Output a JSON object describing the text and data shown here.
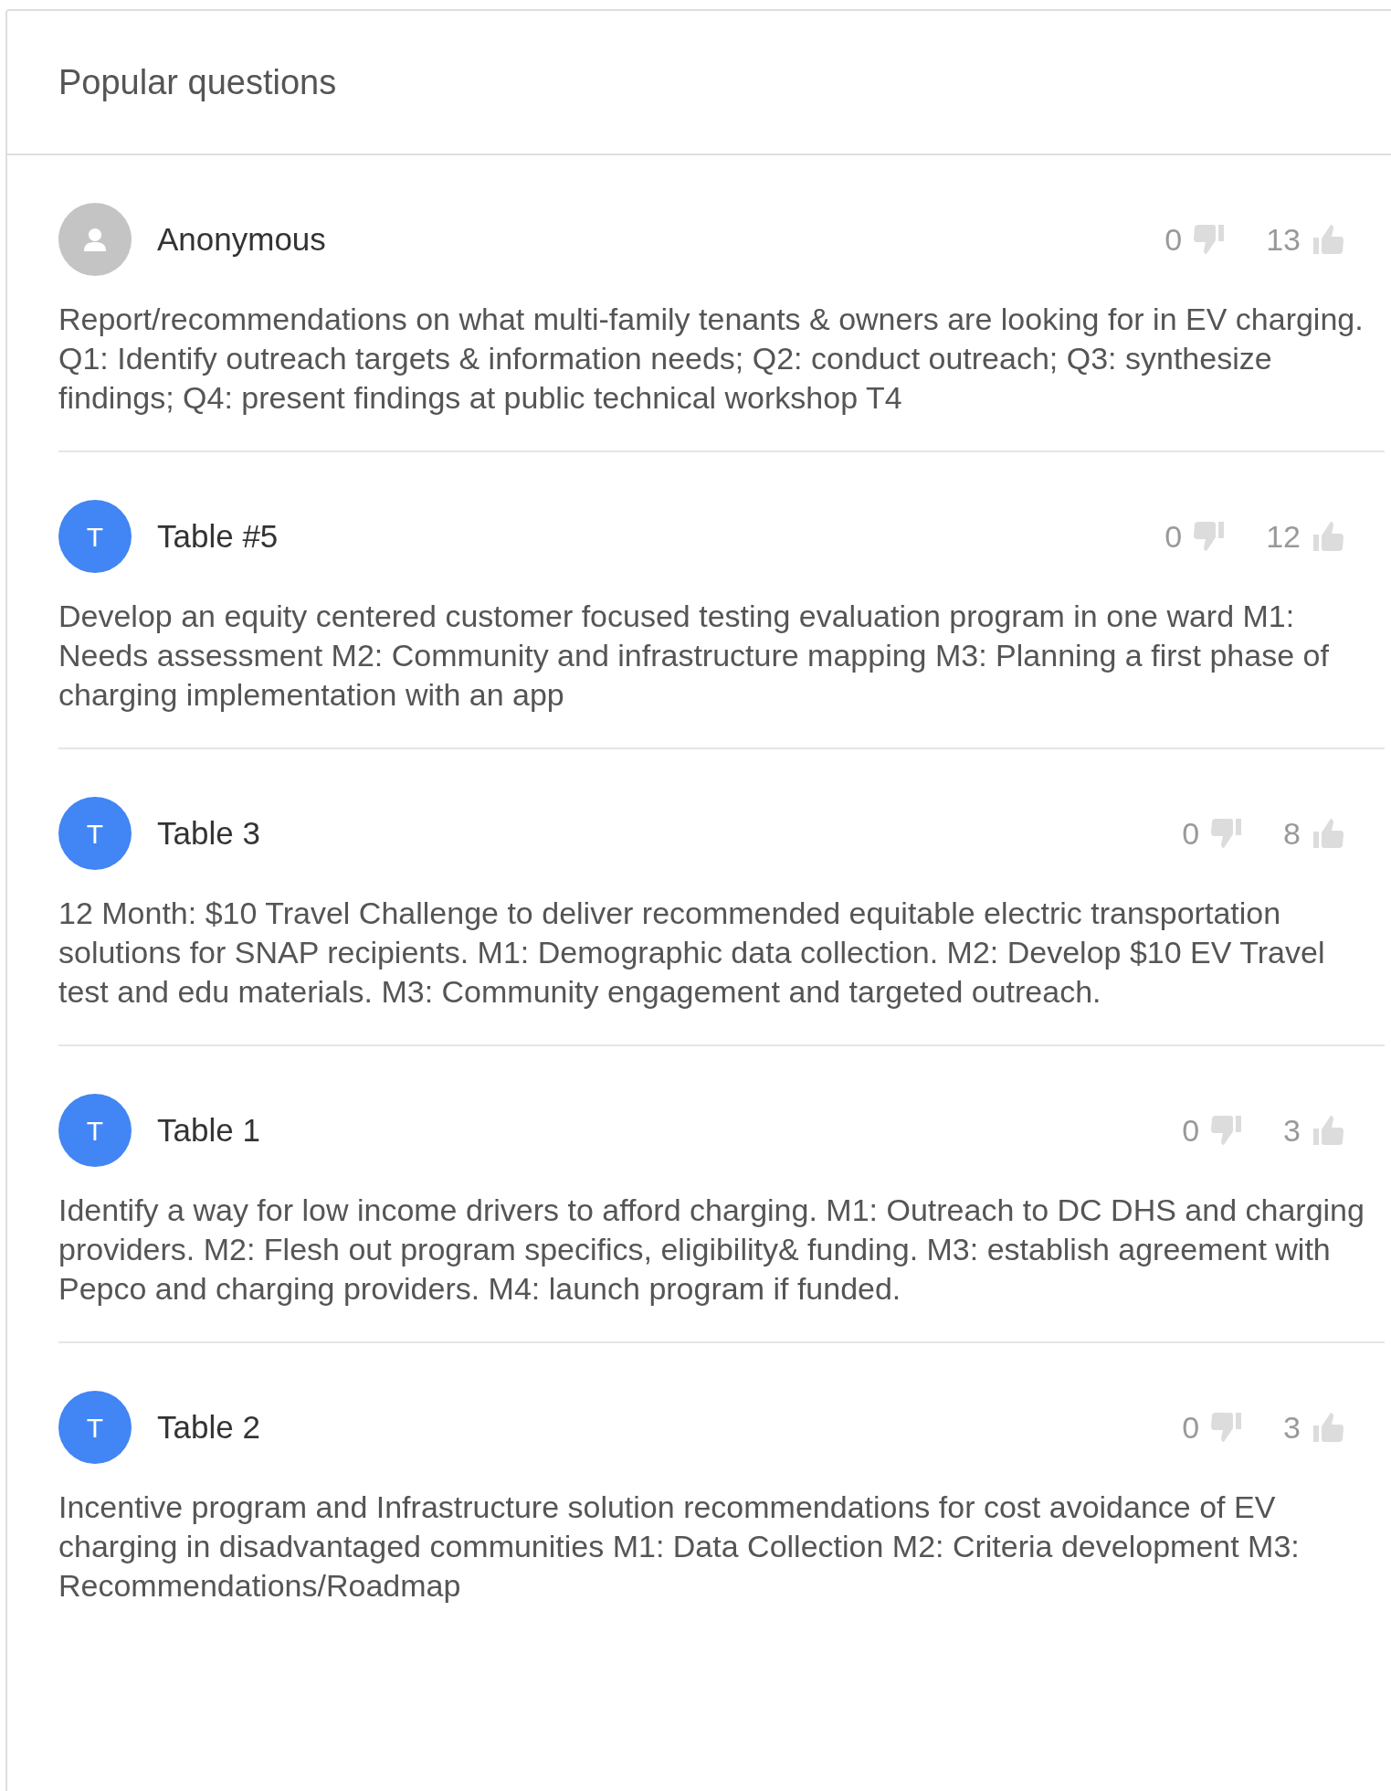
{
  "title": "Popular questions",
  "questions": [
    {
      "author": {
        "kind": "anonymous",
        "name": "Anonymous"
      },
      "downvotes": "0",
      "upvotes": "13",
      "text": "Report/recommendations on what multi-family tenants & owners are looking for in EV charging. Q1: Identify outreach targets & information needs; Q2: conduct outreach; Q3: synthesize findings; Q4: present findings at public technical workshop T4"
    },
    {
      "author": {
        "kind": "initial",
        "initial": "T",
        "name": "Table #5"
      },
      "downvotes": "0",
      "upvotes": "12",
      "text": "Develop an equity centered customer focused testing evaluation program in one ward M1: Needs assessment M2: Community and infrastructure mapping M3: Planning a first phase of charging implementation with an app"
    },
    {
      "author": {
        "kind": "initial",
        "initial": "T",
        "name": "Table 3"
      },
      "downvotes": "0",
      "upvotes": "8",
      "text": "12 Month: $10 Travel Challenge to deliver recommended equitable electric transportation solutions for SNAP recipients. M1: Demographic data collection. M2: Develop $10 EV Travel test and edu materials. M3: Community engagement and targeted outreach."
    },
    {
      "author": {
        "kind": "initial",
        "initial": "T",
        "name": "Table 1"
      },
      "downvotes": "0",
      "upvotes": "3",
      "text": "Identify a way for low income drivers to afford charging. M1: Outreach to DC DHS and charging providers. M2: Flesh out program specifics, eligibility& funding. M3: establish agreement with Pepco and charging providers. M4: launch program if funded."
    },
    {
      "author": {
        "kind": "initial",
        "initial": "T",
        "name": "Table 2"
      },
      "downvotes": "0",
      "upvotes": "3",
      "text": "Incentive program and Infrastructure solution recommendations for cost avoidance of EV charging in disadvantaged communities M1: Data Collection M2: Criteria development M3: Recommendations/Roadmap"
    }
  ]
}
